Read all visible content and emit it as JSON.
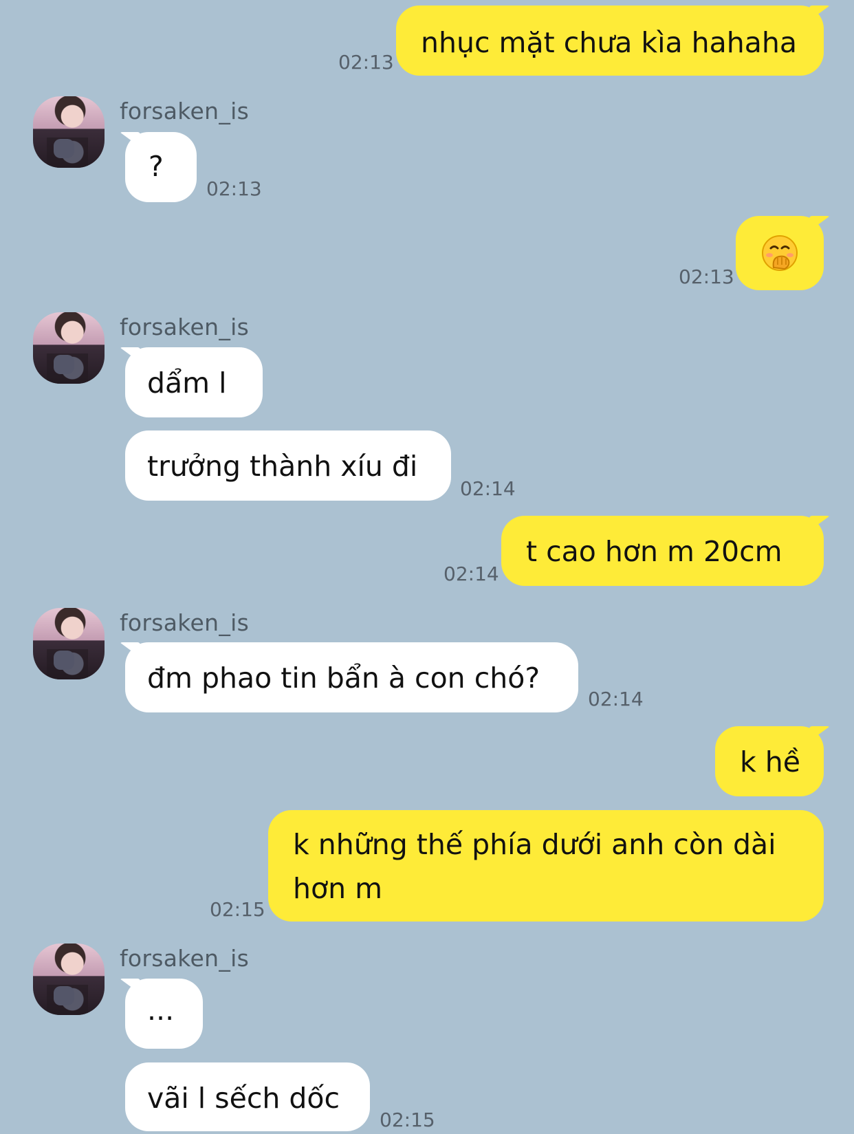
{
  "contact": {
    "name": "forsaken_is"
  },
  "messages": [
    {
      "direction": "out",
      "text": "nhục mặt chưa kìa hahaha",
      "time": "02:13"
    },
    {
      "direction": "in",
      "text": "?",
      "time": "02:13"
    },
    {
      "direction": "out",
      "emoji": "face-with-hand-over-mouth-emoji",
      "time": "02:13"
    },
    {
      "direction": "in",
      "text": "dẩm l"
    },
    {
      "direction": "in",
      "text": "trưởng thành xíu đi",
      "time": "02:14"
    },
    {
      "direction": "out",
      "text": "t cao hơn m 20cm",
      "time": "02:14"
    },
    {
      "direction": "in",
      "text": "đm phao tin bẩn à con chó?",
      "time": "02:14"
    },
    {
      "direction": "out",
      "text": "k hề"
    },
    {
      "direction": "out",
      "text_lines": [
        "k những thế phía dưới anh còn dài",
        "hơn m"
      ],
      "time": "02:15"
    },
    {
      "direction": "in",
      "text": "..."
    },
    {
      "direction": "in",
      "text": "vãi l sếch dốc",
      "time": "02:15"
    }
  ],
  "colors": {
    "background": "#abc1d1",
    "outgoing_bubble": "#feeb38",
    "incoming_bubble": "#ffffff"
  }
}
